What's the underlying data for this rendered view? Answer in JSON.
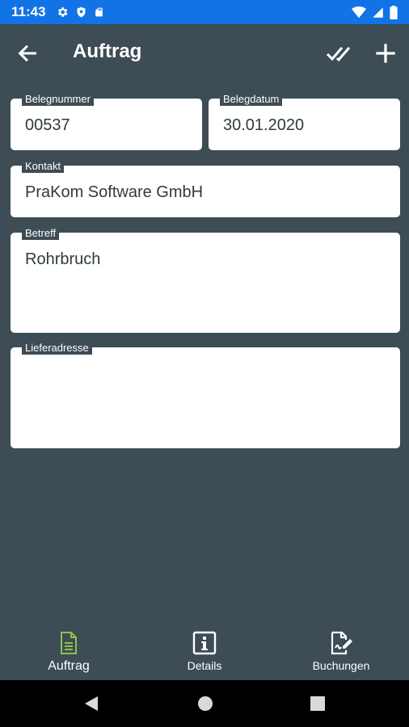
{
  "status_bar": {
    "time": "11:43",
    "left_icons": [
      "gear-icon",
      "shield-icon",
      "sd-card-icon"
    ],
    "right_icons": [
      "wifi-icon",
      "signal-icon",
      "battery-icon"
    ],
    "color": "#1273e6"
  },
  "app_bar": {
    "title": "Auftrag"
  },
  "form": {
    "belegnummer": {
      "label": "Belegnummer",
      "value": "00537"
    },
    "belegdatum": {
      "label": "Belegdatum",
      "value": "30.01.2020"
    },
    "kontakt": {
      "label": "Kontakt",
      "value": "PraKom Software GmbH"
    },
    "betreff": {
      "label": "Betreff",
      "value": "Rohrbruch"
    },
    "lieferadresse": {
      "label": "Lieferadresse",
      "value": ""
    }
  },
  "bottom_nav": {
    "items": [
      {
        "label": "Auftrag",
        "icon": "document-icon",
        "active": true
      },
      {
        "label": "Details",
        "icon": "info-icon",
        "active": false
      },
      {
        "label": "Buchungen",
        "icon": "edit-document-icon",
        "active": false
      }
    ],
    "active_color": "#8bc34a"
  },
  "colors": {
    "background": "#3d4c55",
    "field_background": "#ffffff",
    "field_text": "#2e3a40"
  }
}
